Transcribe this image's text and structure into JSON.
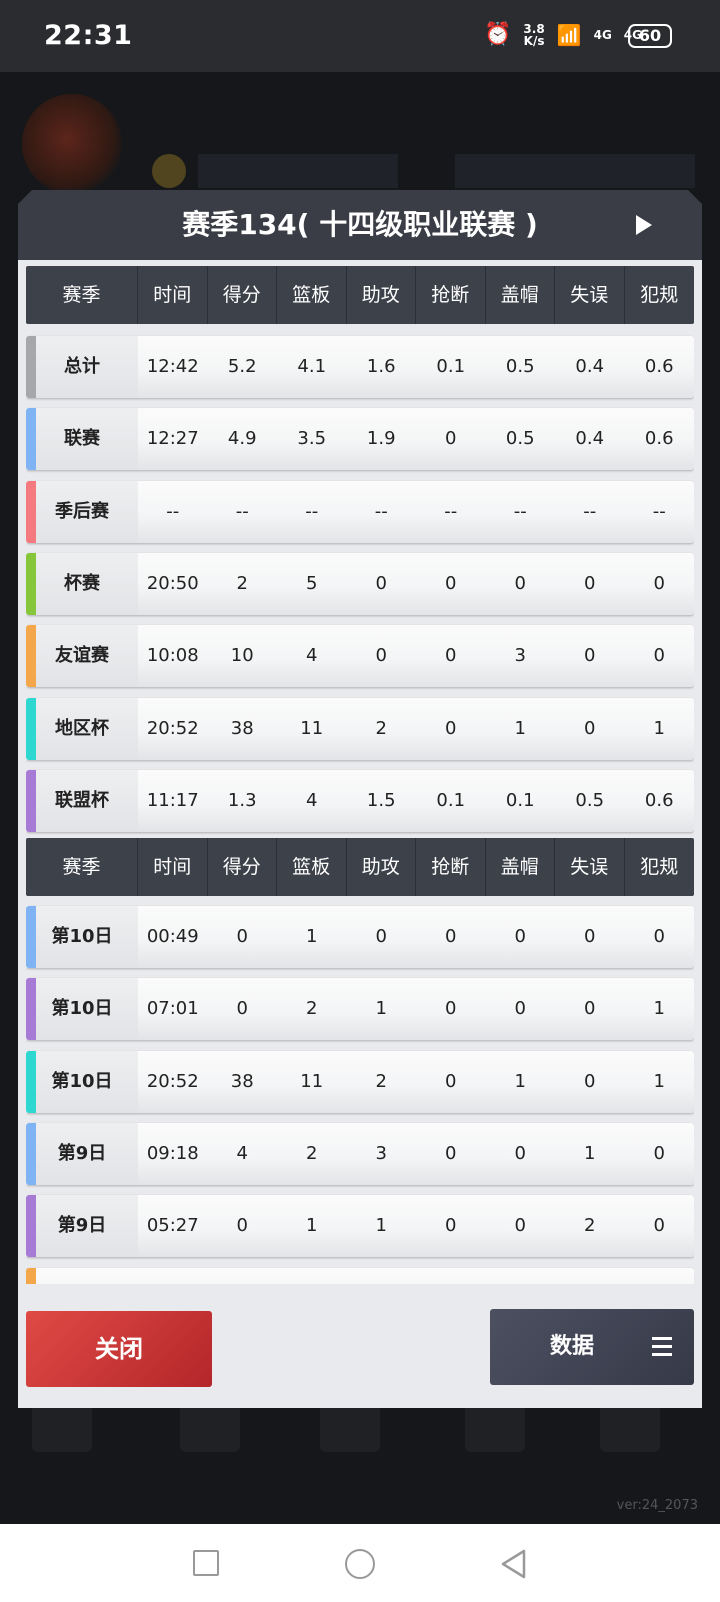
{
  "status": {
    "time": "22:31",
    "net_speed": "3.8\nK/s",
    "signal1": "4G",
    "signal2": "4G",
    "battery": "60"
  },
  "dialog": {
    "title": "赛季134( 十四级职业联赛 )",
    "headers": [
      "赛季",
      "时间",
      "得分",
      "篮板",
      "助攻",
      "抢断",
      "盖帽",
      "失误",
      "犯规"
    ],
    "summary_rows": [
      {
        "label": "总计",
        "color": "#a6a7aa",
        "values": [
          "12:42",
          "5.2",
          "4.1",
          "1.6",
          "0.1",
          "0.5",
          "0.4",
          "0.6"
        ]
      },
      {
        "label": "联赛",
        "color": "#7fb3f4",
        "values": [
          "12:27",
          "4.9",
          "3.5",
          "1.9",
          "0",
          "0.5",
          "0.4",
          "0.6"
        ]
      },
      {
        "label": "季后赛",
        "color": "#f47a80",
        "values": [
          "--",
          "--",
          "--",
          "--",
          "--",
          "--",
          "--",
          "--"
        ]
      },
      {
        "label": "杯赛",
        "color": "#86c63a",
        "values": [
          "20:50",
          "2",
          "5",
          "0",
          "0",
          "0",
          "0",
          "0"
        ]
      },
      {
        "label": "友谊赛",
        "color": "#f4a64a",
        "values": [
          "10:08",
          "10",
          "4",
          "0",
          "0",
          "3",
          "0",
          "0"
        ]
      },
      {
        "label": "地区杯",
        "color": "#2ed8d0",
        "values": [
          "20:52",
          "38",
          "11",
          "2",
          "0",
          "1",
          "0",
          "1"
        ]
      },
      {
        "label": "联盟杯",
        "color": "#a77ad6",
        "values": [
          "11:17",
          "1.3",
          "4",
          "1.5",
          "0.1",
          "0.1",
          "0.5",
          "0.6"
        ]
      }
    ],
    "game_rows": [
      {
        "label": "第10日",
        "color": "#7fb3f4",
        "values": [
          "00:49",
          "0",
          "1",
          "0",
          "0",
          "0",
          "0",
          "0"
        ]
      },
      {
        "label": "第10日",
        "color": "#a77ad6",
        "values": [
          "07:01",
          "0",
          "2",
          "1",
          "0",
          "0",
          "0",
          "1"
        ]
      },
      {
        "label": "第10日",
        "color": "#2ed8d0",
        "values": [
          "20:52",
          "38",
          "11",
          "2",
          "0",
          "1",
          "0",
          "1"
        ]
      },
      {
        "label": "第9日",
        "color": "#7fb3f4",
        "values": [
          "09:18",
          "4",
          "2",
          "3",
          "0",
          "0",
          "1",
          "0"
        ]
      },
      {
        "label": "第9日",
        "color": "#a77ad6",
        "values": [
          "05:27",
          "0",
          "1",
          "1",
          "0",
          "0",
          "2",
          "0"
        ]
      }
    ],
    "close_label": "关闭",
    "data_label": "数据"
  },
  "background": {
    "version": "ver:24_2073"
  }
}
